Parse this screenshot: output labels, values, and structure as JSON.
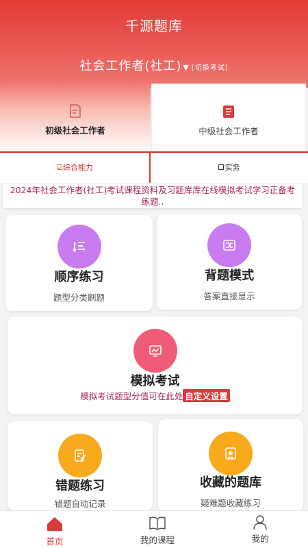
{
  "header": {
    "app_title": "千源题库",
    "exam_name": "社会工作者(社工)",
    "arrow": "▼",
    "switch_label": "[切换考试]"
  },
  "levels": [
    {
      "label": "初级社会工作者",
      "active": true,
      "icon": "document-icon"
    },
    {
      "label": "中级社会工作者",
      "active": false,
      "icon": "list-document-icon"
    }
  ],
  "subjects": [
    {
      "label": "☑综合能力",
      "checked": true
    },
    {
      "label": "实务",
      "checked": false
    }
  ],
  "banner": "2024年社会工作者(社工)考试课程资料及习题库库在线模拟考试学习正备考练题..",
  "cards": {
    "sequential": {
      "title": "顺序练习",
      "desc": "题型分类刷题",
      "icon": "ordered-list-icon",
      "color": "#c87cf0"
    },
    "memorize": {
      "title": "背题模式",
      "desc": "答案直接显示",
      "icon": "shuffle-icon",
      "color": "#c87cf0"
    },
    "mock": {
      "title": "模拟考试",
      "desc": "模拟考试题型分值可在此处",
      "button": "自定义设置",
      "icon": "chart-screen-icon",
      "color": "#f05c77"
    },
    "wrong": {
      "title": "错题练习",
      "desc": "错题自动记录",
      "icon": "note-edit-icon",
      "color": "#f9a91c"
    },
    "favorites": {
      "title": "收藏的题库",
      "desc": "疑难题收藏练习",
      "icon": "star-book-icon",
      "color": "#f9a91c"
    }
  },
  "tabs": [
    {
      "label": "首页",
      "icon": "home-icon",
      "active": true
    },
    {
      "label": "我的课程",
      "icon": "book-icon",
      "active": false
    },
    {
      "label": "我的",
      "icon": "person-icon",
      "active": false
    }
  ],
  "colors": {
    "brand_red": "#e23b36",
    "accent_red": "#d93a3a",
    "banner_text": "#a8285e"
  }
}
